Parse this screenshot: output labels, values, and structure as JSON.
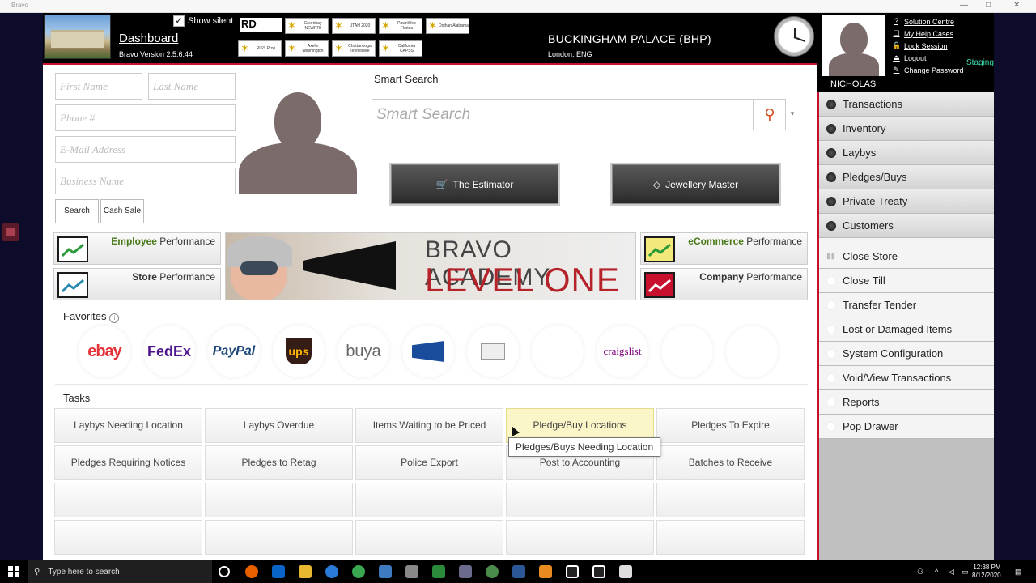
{
  "window": {
    "title": "Bravo",
    "controls": [
      "—",
      "□",
      "✕"
    ]
  },
  "header": {
    "dashboard_title": "Dashboard",
    "version": "Bravo Version 2.5.6.44",
    "show_silent_label": "Show silent",
    "show_silent_checked": "✓",
    "rd_badge": "RD",
    "stores": [
      {
        "label": "Greenbay NEWPRI"
      },
      {
        "label": "UTAH 2020"
      },
      {
        "label": "PawnWeb Florida"
      },
      {
        "label": "Dothan Alabama"
      },
      {
        "label": "RISS Prop"
      },
      {
        "label": "Axel's Washington"
      },
      {
        "label": "Chattanooga Tennessee"
      },
      {
        "label": "California CAPSS"
      }
    ],
    "location_name": "BUCKINGHAM PALACE (BHP)",
    "location_sub": "London, ENG",
    "user_name": "NICHOLAS",
    "user_links": [
      {
        "icon": "?",
        "label": "Solution Centre"
      },
      {
        "icon": "☐",
        "label": "My Help Cases"
      },
      {
        "icon": "🔒",
        "label": "Lock Session"
      },
      {
        "icon": "⏏",
        "label": "Logout"
      },
      {
        "icon": "✎",
        "label": "Change Password"
      }
    ],
    "staging": "Staging"
  },
  "customer_search": {
    "first_name_placeholder": "First Name",
    "last_name_placeholder": "Last Name",
    "phone_placeholder": "Phone #",
    "email_placeholder": "E-Mail Address",
    "business_placeholder": "Business Name",
    "search_button": "Search",
    "cash_sale_button": "Cash Sale"
  },
  "smart_search": {
    "title": "Smart Search",
    "placeholder": "Smart Search",
    "search_icon": "⚲",
    "dropdown_icon": "▾"
  },
  "tools": {
    "estimator_label": "The Estimator",
    "estimator_icon": "🛒",
    "jewellery_label": "Jewellery Master",
    "jewellery_icon": "◇"
  },
  "performance": {
    "employee_bold": "Employee",
    "employee_rest": " Performance",
    "store_bold": "Store",
    "store_rest": " Performance",
    "ecommerce_bold": "eCommerce",
    "ecommerce_rest": " Performance",
    "company_bold": "Company",
    "company_rest": " Performance"
  },
  "banner": {
    "line1": "BRAVO ACADEMY",
    "line2": "LEVEL ONE"
  },
  "favorites": {
    "title": "Favorites",
    "info_icon": "i",
    "items": [
      {
        "name": "ebay",
        "label": "ebay"
      },
      {
        "name": "fedex",
        "label": "FedEx"
      },
      {
        "name": "paypal",
        "label": "PayPal"
      },
      {
        "name": "ups",
        "label": "ups"
      },
      {
        "name": "buya",
        "label": "buya"
      },
      {
        "name": "usps",
        "label": ""
      },
      {
        "name": "mail",
        "label": ""
      },
      {
        "name": "blank1",
        "label": ""
      },
      {
        "name": "craigslist",
        "label": "craigslist"
      },
      {
        "name": "blank2",
        "label": ""
      },
      {
        "name": "blank3",
        "label": ""
      }
    ]
  },
  "tasks": {
    "title": "Tasks",
    "row1": [
      "Laybys Needing Location",
      "Laybys Overdue",
      "Items Waiting to be Priced",
      "Pledge/Buy Locations",
      "Pledges To Expire"
    ],
    "row2": [
      "Pledges Requiring Notices",
      "Pledges to Retag",
      "Police Export",
      "Post to Accounting",
      "Batches to Receive"
    ],
    "tooltip": "Pledges/Buys Needing Location"
  },
  "sidebar": {
    "primary": [
      "Transactions",
      "Inventory",
      "Laybys",
      "Pledges/Buys",
      "Private Treaty",
      "Customers"
    ],
    "secondary": [
      "Close Store",
      "Close Till",
      "Transfer Tender",
      "Lost or Damaged Items",
      "System Configuration",
      "Void/View Transactions",
      "Reports",
      "Pop Drawer"
    ]
  },
  "taskbar": {
    "search_placeholder": "Type here to search",
    "time": "12:38 PM",
    "date": "8/12/2020"
  },
  "colors": {
    "accent_red": "#c8102e",
    "staging_green": "#3de0b0",
    "highlight_yellow": "#fbf6c8"
  }
}
